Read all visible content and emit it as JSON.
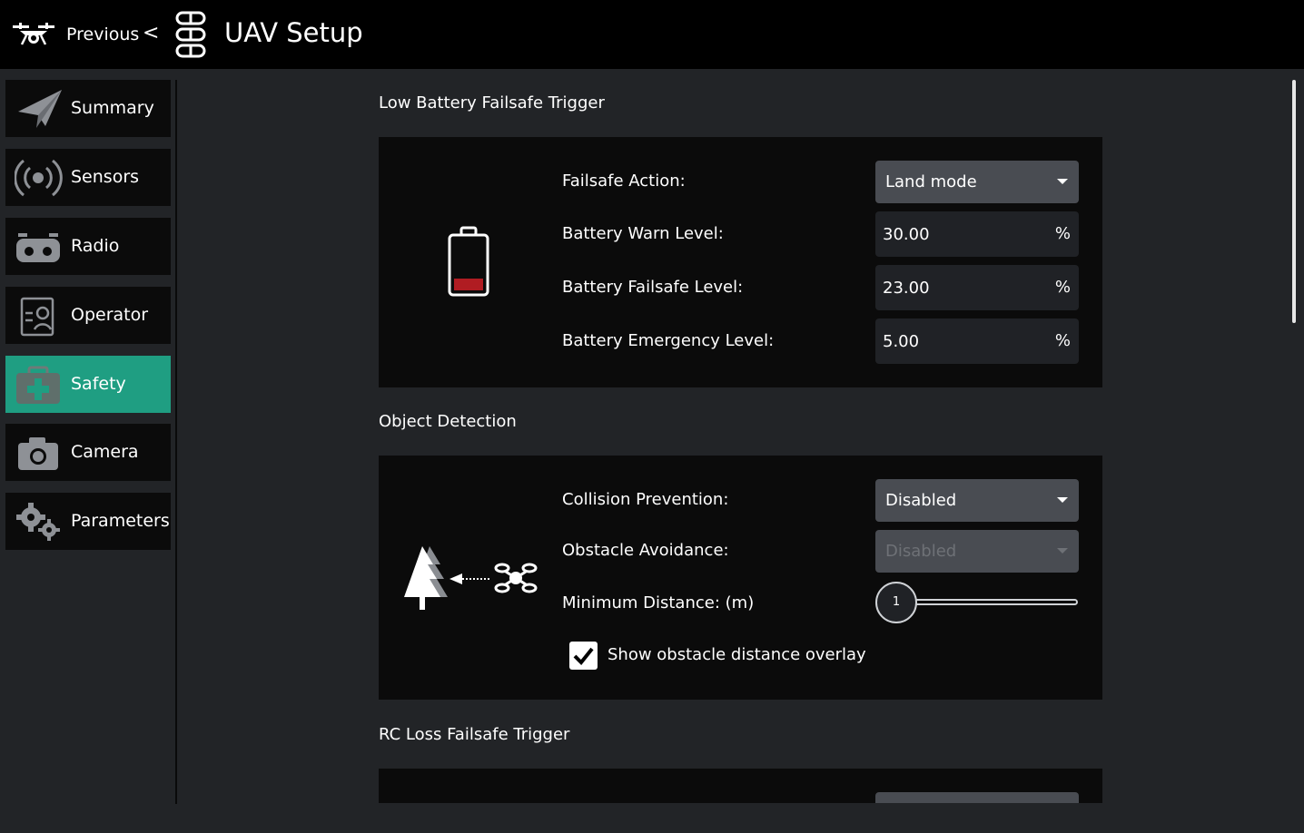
{
  "header": {
    "previous_label": "Previous",
    "previous_chevron": "<",
    "title": "UAV Setup",
    "logo_icon": "drone-icon",
    "setup_icon": "vehicle-setup-icon"
  },
  "sidebar": {
    "items": [
      {
        "label": "Summary",
        "icon": "paper-plane-icon",
        "active": false
      },
      {
        "label": "Sensors",
        "icon": "sensor-signal-icon",
        "active": false
      },
      {
        "label": "Radio",
        "icon": "radio-controller-icon",
        "active": false
      },
      {
        "label": "Operator",
        "icon": "operator-icon",
        "active": false
      },
      {
        "label": "Safety",
        "icon": "first-aid-kit-icon",
        "active": true
      },
      {
        "label": "Camera",
        "icon": "camera-icon",
        "active": false
      },
      {
        "label": "Parameters",
        "icon": "gears-icon",
        "active": false
      }
    ],
    "active_color": "#1f9e82"
  },
  "low_battery": {
    "title": "Low Battery Failsafe Trigger",
    "failsafe_action_label": "Failsafe Action:",
    "failsafe_action_value": "Land mode",
    "warn_label": "Battery Warn Level:",
    "warn_value": "30.00",
    "failsafe_label": "Battery Failsafe Level:",
    "failsafe_value": "23.00",
    "emergency_label": "Battery Emergency Level:",
    "emergency_value": "5.00",
    "unit": "%",
    "icon": "battery-low-icon"
  },
  "object_detection": {
    "title": "Object Detection",
    "collision_label": "Collision Prevention:",
    "collision_value": "Disabled",
    "avoidance_label": "Obstacle Avoidance:",
    "avoidance_value": "Disabled",
    "min_distance_label": "Minimum Distance: (m)",
    "min_distance_value": "1",
    "overlay_label": "Show obstacle distance overlay",
    "overlay_checked": true,
    "icon": "obstacle-detection-icon"
  },
  "rc_loss": {
    "title": "RC Loss Failsafe Trigger"
  }
}
